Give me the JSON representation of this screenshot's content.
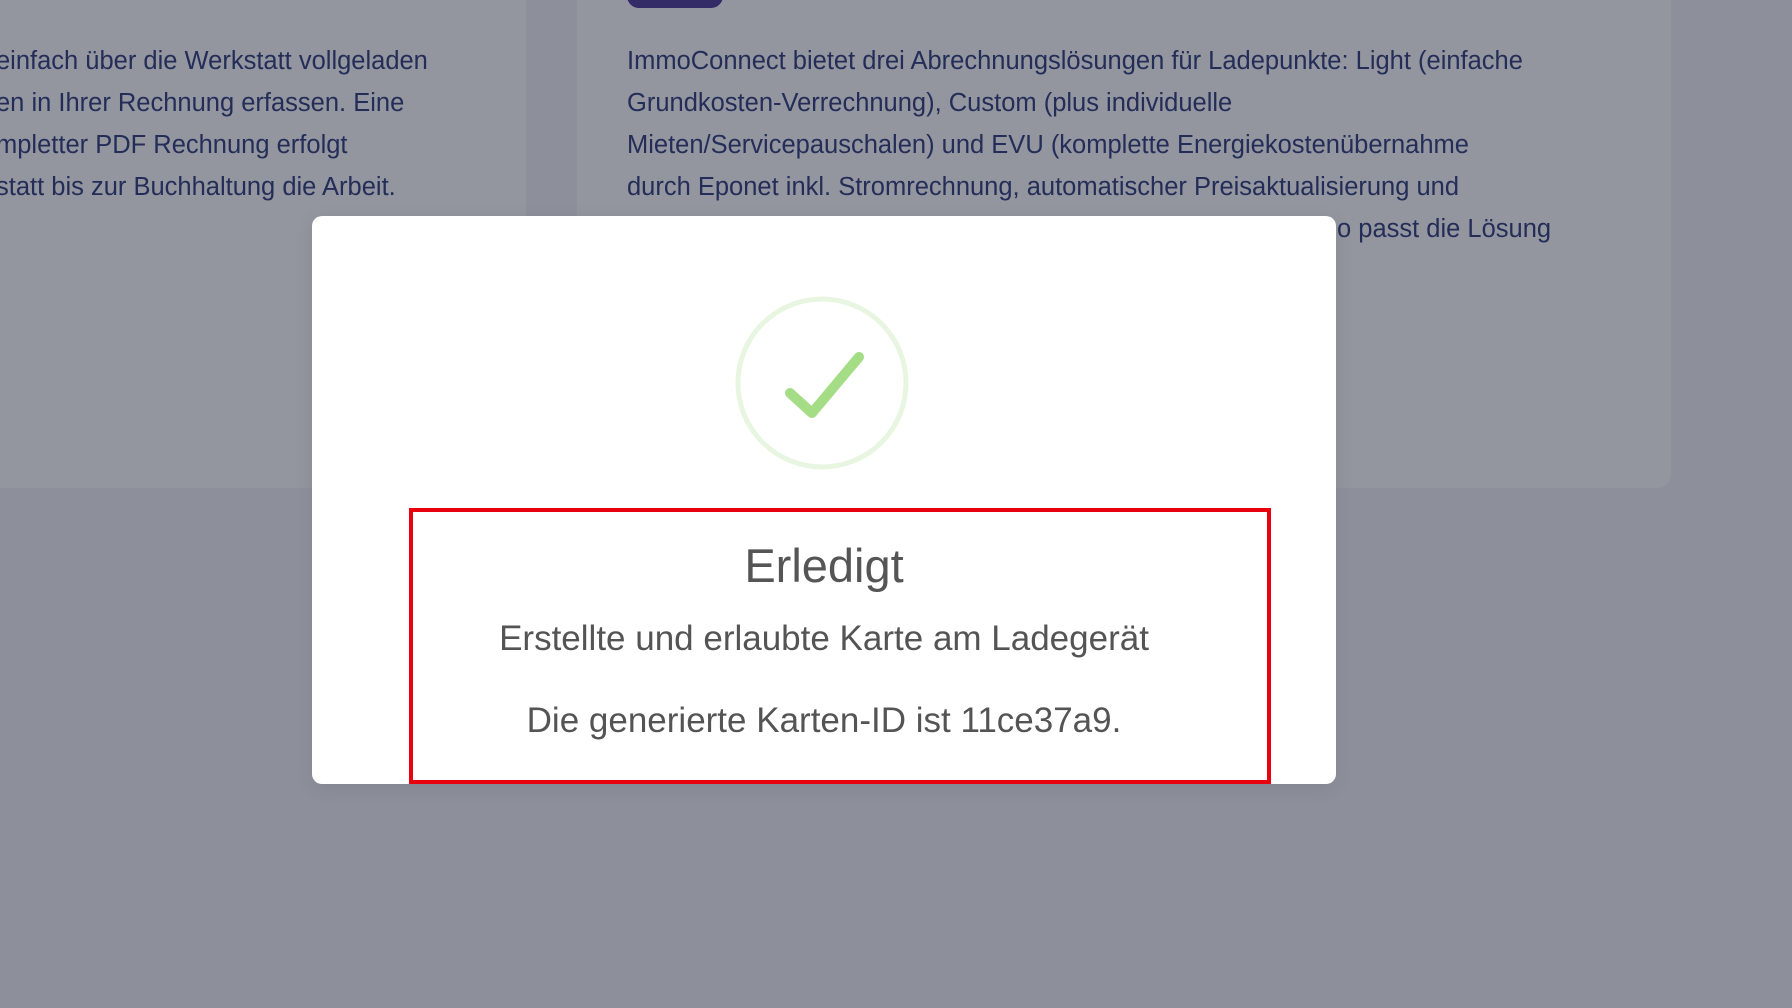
{
  "background": {
    "left_card": {
      "lines": [
        "einfach über die Werkstatt vollgeladen",
        "en in Ihrer Rechnung erfassen. Eine",
        "mpletter PDF Rechnung erfolgt",
        "statt bis zur Buchhaltung die Arbeit."
      ]
    },
    "right_card": {
      "lines": [
        "ImmoConnect bietet drei Abrechnungslösungen für Ladepunkte: Light (einfache",
        "Grundkosten-Verrechnung), Custom (plus individuelle",
        "Mieten/Servicepauschalen) und EVU (komplette Energiekostenübernahme",
        "durch Eponet inkl. Stromrechnung, automatischer Preisaktualisierung und",
        "o passt die Lösung"
      ]
    }
  },
  "modal": {
    "icon": "success-check-icon",
    "title": "Erledigt",
    "message": "Erstellte und erlaubte Karte am Ladegerät",
    "detail": "Die generierte Karten-ID ist 11ce37a9."
  },
  "colors": {
    "overlay": "rgba(40, 44, 64, 0.5)",
    "check": "#a5dc86",
    "check_ring": "rgba(165, 220, 134, 0.25)",
    "highlight": "#e8000e",
    "card_text": "#1f2f6e",
    "tag": "#3f2d8f"
  }
}
